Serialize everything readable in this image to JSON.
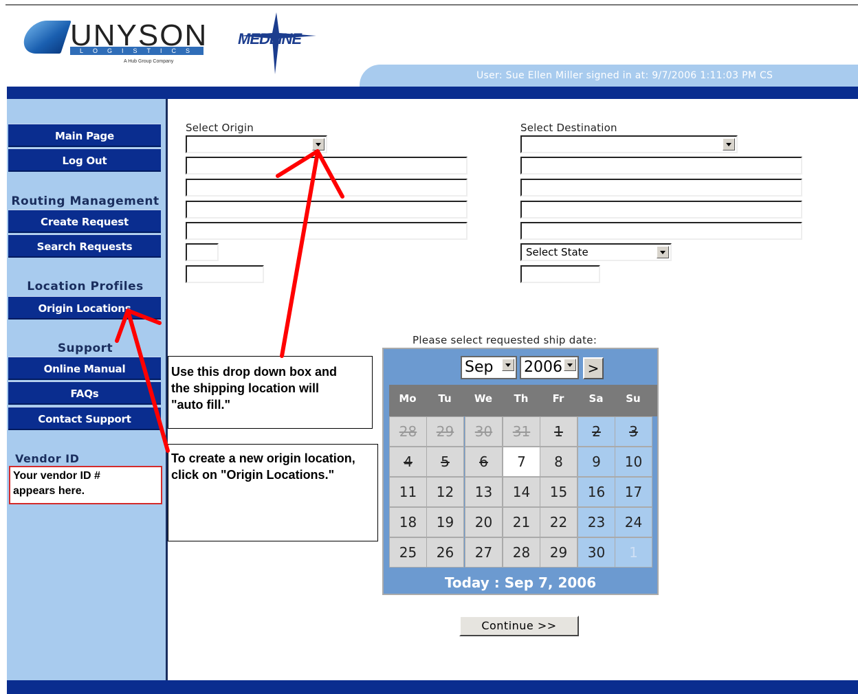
{
  "logos": {
    "unyson_word": "UNYSON",
    "unyson_sub": "LOGISTICS",
    "unyson_tagline": "A Hub Group Company",
    "medline": "MEDLINE"
  },
  "header": {
    "user_status": "User: Sue Ellen Miller signed in at: 9/7/2006 1:11:03 PM CS"
  },
  "sidebar": {
    "main_page": "Main Page",
    "log_out": "Log Out",
    "routing_heading": "Routing Management",
    "create_request": "Create Request",
    "search_requests": "Search Requests",
    "location_heading": "Location Profiles",
    "origin_locations": "Origin Locations",
    "support_heading": "Support",
    "online_manual": "Online Manual",
    "faqs": "FAQs",
    "contact_support": "Contact Support",
    "vendor_label": "Vendor ID",
    "vendor_note_1": "Your vendor ID #",
    "vendor_note_2": "appears here."
  },
  "form": {
    "origin_label": "Select Origin",
    "origin_value": "",
    "destination_label": "Select Destination",
    "destination_value": "",
    "state_select": "Select State"
  },
  "callouts": {
    "dropdown_1": "Use this drop down box and",
    "dropdown_2": "the shipping location will",
    "dropdown_3": "\"auto fill.\"",
    "origin_1": "To create a new origin location,",
    "origin_2": "click on \"Origin Locations.\""
  },
  "calendar": {
    "prompt": "Please select requested ship date:",
    "month": "Sep",
    "year": "2006",
    "next": ">",
    "weekdays": [
      "Mo",
      "Tu",
      "We",
      "Th",
      "Fr",
      "Sa",
      "Su"
    ],
    "weeks": [
      [
        "28",
        "29",
        "30",
        "31",
        "1",
        "2",
        "3"
      ],
      [
        "4",
        "5",
        "6",
        "7",
        "8",
        "9",
        "10"
      ],
      [
        "11",
        "12",
        "13",
        "14",
        "15",
        "16",
        "17"
      ],
      [
        "18",
        "19",
        "20",
        "21",
        "22",
        "23",
        "24"
      ],
      [
        "25",
        "26",
        "27",
        "28",
        "29",
        "30",
        "1"
      ]
    ],
    "today_text": "Today : Sep 7, 2006"
  },
  "actions": {
    "continue": "Continue >>"
  },
  "colors": {
    "navy": "#0a2d8f",
    "sidebar_bg": "#a8cbee",
    "annotation_red": "#ff0000",
    "calendar_blue": "#6c9ad0"
  }
}
